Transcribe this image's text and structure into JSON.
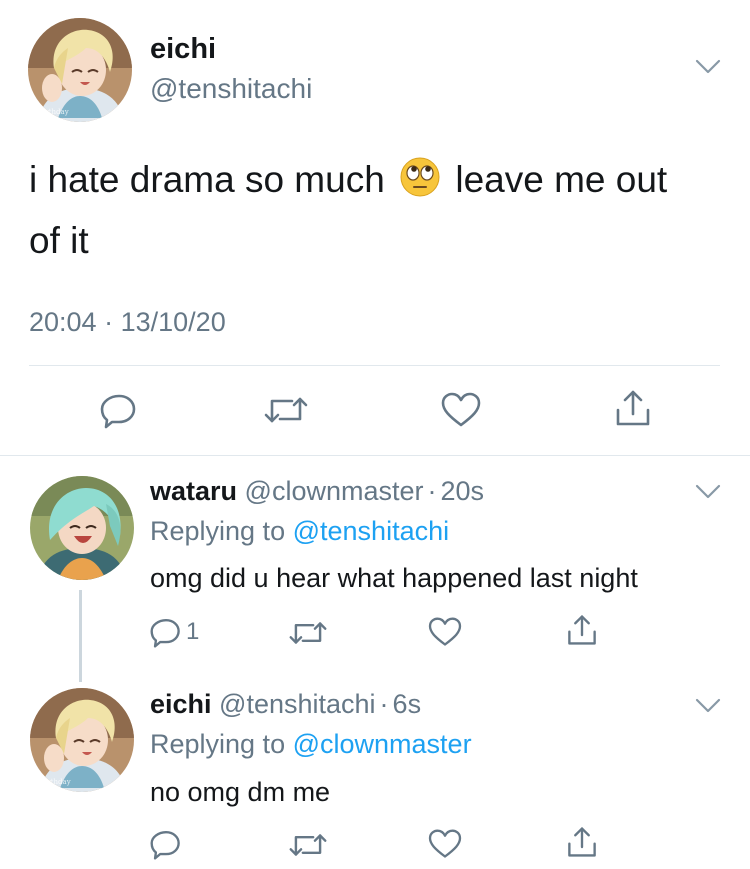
{
  "main_tweet": {
    "display_name": "eichi",
    "handle": "@tenshitachi",
    "text_before_emoji": "i hate drama so much",
    "emoji": "face-with-rolling-eyes",
    "text_after_emoji": "leave me out",
    "text_line2": "of it",
    "time": "20:04",
    "date": "13/10/20",
    "separator": "·"
  },
  "replies": [
    {
      "display_name": "wataru",
      "handle": "@clownmaster",
      "dot": "·",
      "age": "20s",
      "replying_prefix": "Replying to",
      "replying_to": "@tenshitachi",
      "text": "omg did u hear what happened last night",
      "reply_count": "1"
    },
    {
      "display_name": "eichi",
      "handle": "@tenshitachi",
      "dot": "·",
      "age": "6s",
      "replying_prefix": "Replying to",
      "replying_to": "@clownmaster",
      "text": "no omg dm me",
      "reply_count": ""
    }
  ],
  "colors": {
    "text": "#14171a",
    "secondary": "#657786",
    "link": "#1da1f2",
    "divider": "#e1e8ed"
  },
  "icons": [
    "chevron-down-icon",
    "reply-icon",
    "retweet-icon",
    "like-icon",
    "share-icon"
  ]
}
